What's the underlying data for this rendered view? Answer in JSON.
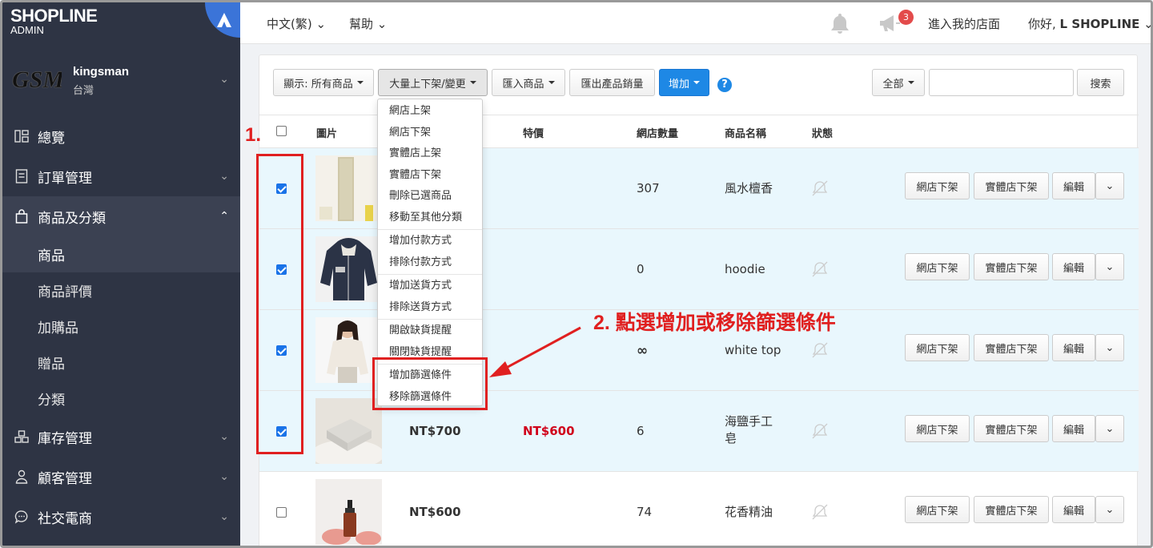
{
  "brand": {
    "logo_main": "SHOPLINE",
    "logo_sub": "ADMIN"
  },
  "store": {
    "logo_text": "GSM",
    "name": "kingsman",
    "region": "台灣"
  },
  "nav": {
    "dashboard": "總覽",
    "orders": "訂單管理",
    "products": "商品及分類",
    "products_sub": [
      "商品",
      "商品評價",
      "加購品",
      "贈品",
      "分類"
    ],
    "inventory": "庫存管理",
    "customers": "顧客管理",
    "social": "社交電商"
  },
  "topbar": {
    "language": "中文(繁)",
    "help": "幫助",
    "notification_count": "3",
    "enter_store": "進入我的店面",
    "greeting": "你好, ",
    "user": "L SHOPLINE"
  },
  "toolbar": {
    "display": "顯示: 所有商品",
    "bulk": "大量上下架/變更",
    "import": "匯入商品",
    "export_sales": "匯出產品銷量",
    "add": "增加",
    "help": "?",
    "filter_all": "全部",
    "search_value": "",
    "search_button": "搜索"
  },
  "columns": [
    "圖片",
    "特價",
    "網店數量",
    "商品名稱",
    "狀態"
  ],
  "dropdown_groups": [
    [
      "網店上架",
      "網店下架",
      "實體店上架",
      "實體店下架",
      "刪除已選商品",
      "移動至其他分類"
    ],
    [
      "增加付款方式",
      "排除付款方式"
    ],
    [
      "增加送貨方式",
      "排除送貨方式"
    ],
    [
      "開啟缺貨提醒",
      "關閉缺貨提醒"
    ],
    [
      "增加篩選條件",
      "移除篩選條件"
    ]
  ],
  "row_actions": {
    "online_unlist": "網店下架",
    "store_unlist": "實體店下架",
    "edit": "編輯"
  },
  "rows": [
    {
      "checked": true,
      "price": "",
      "special_price": "",
      "quantity": "307",
      "name": "風水檀香"
    },
    {
      "checked": true,
      "price": "",
      "special_price": "",
      "quantity": "0",
      "name": "hoodie"
    },
    {
      "checked": true,
      "price": "",
      "special_price": "",
      "quantity": "∞",
      "name": "white top"
    },
    {
      "checked": true,
      "price": "NT$700",
      "special_price": "NT$600",
      "quantity": "6",
      "name": "海鹽手工皂"
    },
    {
      "checked": false,
      "price": "NT$600",
      "special_price": "",
      "quantity": "74",
      "name": "花香精油"
    }
  ],
  "annotations": {
    "step1": "1.",
    "step2": "2. 點選增加或移除篩選條件"
  },
  "colors": {
    "sidebar": "#2e3444",
    "accent": "#1e88e5",
    "selected_row": "#e9f7fd",
    "annotation": "#e02020",
    "sale_price": "#d0021b"
  }
}
